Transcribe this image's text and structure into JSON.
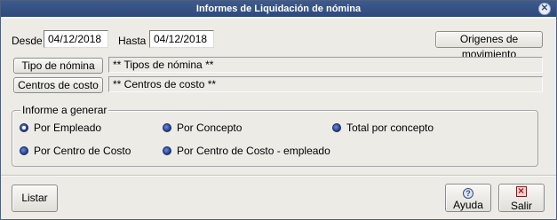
{
  "window": {
    "title": "Informes de Liquidación de nómina"
  },
  "dates": {
    "desde_label": "Desde",
    "desde_value": "04/12/2018",
    "hasta_label": "Hasta",
    "hasta_value": "04/12/2018"
  },
  "origenes_button": "Origenes de movimiento",
  "tipo_nomina": {
    "button": "Tipo de nómina",
    "value": "** Tipos de nómina **"
  },
  "centros_costo": {
    "button": "Centros de costo",
    "value": "** Centros de costo **"
  },
  "informe": {
    "legend": "Informe a generar",
    "options": [
      {
        "label": "Por Empleado",
        "checked": true
      },
      {
        "label": "Por Concepto",
        "checked": false
      },
      {
        "label": "Total por concepto",
        "checked": false
      },
      {
        "label": "Por Centro de Costo",
        "checked": false
      },
      {
        "label": "Por Centro de Costo - empleado",
        "checked": false
      }
    ]
  },
  "footer": {
    "listar": "Listar",
    "ayuda": "Ayuda",
    "salir": "Salir"
  },
  "icons": {
    "close": "close-icon",
    "help": "help-icon",
    "exit": "exit-icon"
  },
  "colors": {
    "titlebar": "#2e4a7c",
    "background": "#ecebe6",
    "radio": "#1c3a8c"
  }
}
